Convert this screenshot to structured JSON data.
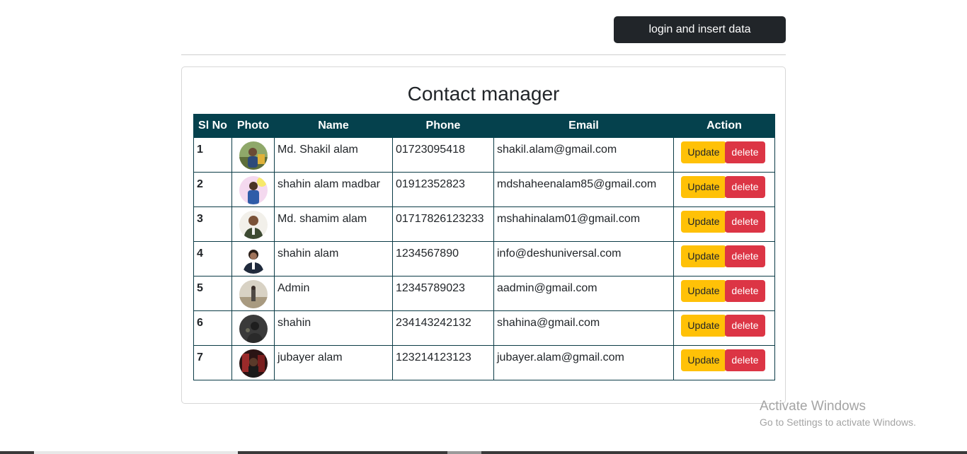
{
  "header": {
    "login_button_label": "login and insert data"
  },
  "card": {
    "title": "Contact manager"
  },
  "table": {
    "columns": [
      "Sl No",
      "Photo",
      "Name",
      "Phone",
      "Email",
      "Action"
    ],
    "rows": [
      {
        "sl": "1",
        "name": "Md. Shakil alam",
        "phone": "01723095418",
        "email": "shakil.alam@gmail.com"
      },
      {
        "sl": "2",
        "name": "shahin alam madbar",
        "phone": "01912352823",
        "email": "mdshaheenalam85@gmail.com"
      },
      {
        "sl": "3",
        "name": "Md. shamim alam",
        "phone": "01717826123233",
        "email": "mshahinalam01@gmail.com"
      },
      {
        "sl": "4",
        "name": "shahin alam",
        "phone": "1234567890",
        "email": "info@deshuniversal.com"
      },
      {
        "sl": "5",
        "name": "Admin",
        "phone": "12345789023",
        "email": "aadmin@gmail.com"
      },
      {
        "sl": "6",
        "name": "shahin",
        "phone": "234143242132",
        "email": "shahina@gmail.com"
      },
      {
        "sl": "7",
        "name": "jubayer alam",
        "phone": "123214123123",
        "email": "jubayer.alam@gmail.com"
      }
    ],
    "update_label": "Update",
    "delete_label": "delete"
  },
  "watermark": {
    "title": "Activate Windows",
    "subtitle": "Go to Settings to activate Windows."
  },
  "colors": {
    "header_bg": "#05414d",
    "update": "#ffc107",
    "delete": "#dc3545",
    "dark_button": "#212529"
  }
}
